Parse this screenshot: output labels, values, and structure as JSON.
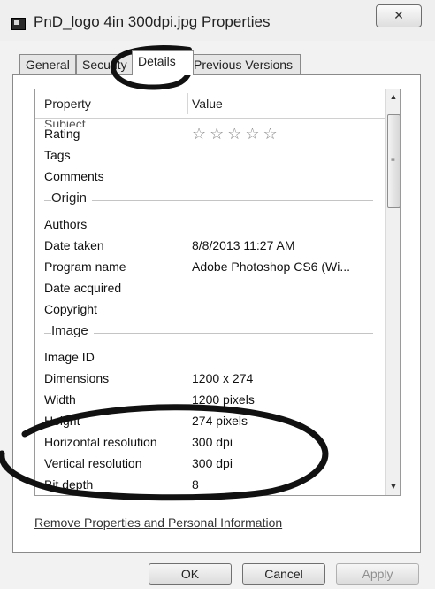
{
  "window": {
    "title": "PnD_logo 4in 300dpi.jpg Properties",
    "close_glyph": "✕"
  },
  "tabs": [
    {
      "label": "General"
    },
    {
      "label": "Security"
    },
    {
      "label": "Details",
      "active": true
    },
    {
      "label": "Previous Versions"
    }
  ],
  "list": {
    "headers": {
      "property": "Property",
      "value": "Value"
    },
    "cut_row": "Subject",
    "rows": [
      {
        "name": "Rating",
        "stars": "☆☆☆☆☆"
      },
      {
        "name": "Tags",
        "value": ""
      },
      {
        "name": "Comments",
        "value": ""
      },
      {
        "group": "Origin"
      },
      {
        "name": "Authors",
        "value": ""
      },
      {
        "name": "Date taken",
        "value": "8/8/2013 11:27 AM"
      },
      {
        "name": "Program name",
        "value": "Adobe Photoshop CS6 (Wi..."
      },
      {
        "name": "Date acquired",
        "value": ""
      },
      {
        "name": "Copyright",
        "value": ""
      },
      {
        "group": "Image"
      },
      {
        "name": "Image ID",
        "value": ""
      },
      {
        "name": "Dimensions",
        "value": "1200 x 274"
      },
      {
        "name": "Width",
        "value": "1200 pixels"
      },
      {
        "name": "Height",
        "value": "274 pixels"
      },
      {
        "name": "Horizontal resolution",
        "value": "300 dpi"
      },
      {
        "name": "Vertical resolution",
        "value": "300 dpi"
      },
      {
        "name": "Bit depth",
        "value": "8"
      }
    ]
  },
  "scrollbar": {
    "up": "▲",
    "down": "▼",
    "grip": "≡"
  },
  "remove_link": "Remove Properties and Personal Information",
  "buttons": {
    "ok": "OK",
    "cancel": "Cancel",
    "apply": "Apply"
  },
  "colors": {
    "annotation_ink": "#111111"
  }
}
